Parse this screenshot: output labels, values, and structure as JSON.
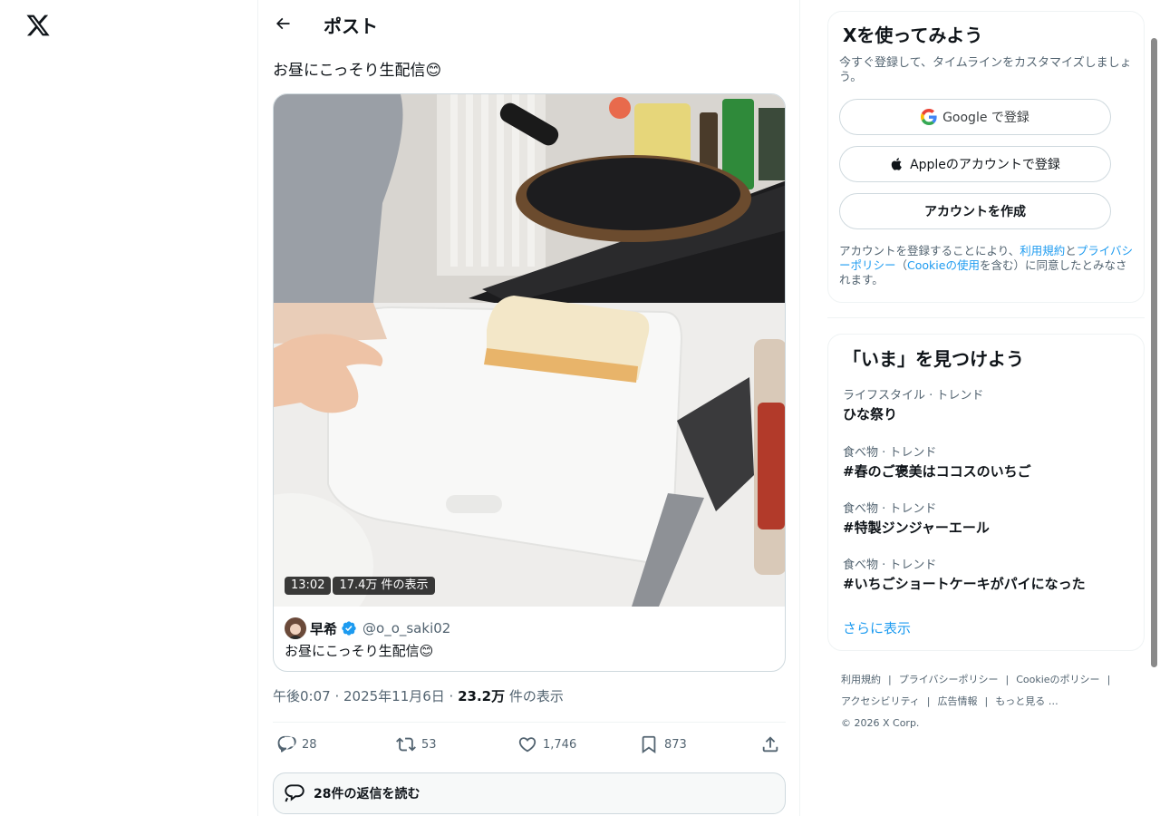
{
  "header": {
    "title": "ポスト"
  },
  "post": {
    "text": "お昼にこっそり生配信😊",
    "video": {
      "duration": "13:02",
      "views": "17.4万 件の表示"
    },
    "quote": {
      "name": "早希",
      "handle": "@o_o_saki02",
      "text": "お昼にこっそり生配信😊"
    },
    "time": "午後0:07 · 2025年11月6日 · ",
    "views_count": "23.2万",
    "views_label": " 件の表示",
    "actions": {
      "replies": "28",
      "reposts": "53",
      "likes": "1,746",
      "bookmarks": "873"
    },
    "read_replies": "28件の返信を読む"
  },
  "signup": {
    "title": "Xを使ってみよう",
    "description": "今すぐ登録して、タイムラインをカスタマイズしましょう。",
    "google_label": "Google で登録",
    "apple_label": "Appleのアカウントで登録",
    "create_label": "アカウントを作成",
    "terms_prefix": "アカウントを登録することにより、",
    "terms_link": "利用規約",
    "terms_and": "と",
    "privacy_link": "プライバシーポリシー",
    "cookie_open": "（",
    "cookie_link": "Cookieの使用",
    "terms_suffix": "を含む）に同意したとみなされます。"
  },
  "trends": {
    "title": "「いま」を見つけよう",
    "items": [
      {
        "category": "ライフスタイル · トレンド",
        "name": "ひな祭り"
      },
      {
        "category": "食べ物 · トレンド",
        "name": "#春のご褒美はココスのいちご"
      },
      {
        "category": "食べ物 · トレンド",
        "name": "#特製ジンジャーエール"
      },
      {
        "category": "食べ物 · トレンド",
        "name": "#いちごショートケーキがパイになった"
      }
    ],
    "show_more": "さらに表示"
  },
  "footer": {
    "links": [
      "利用規約",
      "プライバシーポリシー",
      "Cookieのポリシー",
      "アクセシビリティ",
      "広告情報",
      "もっと見る …"
    ],
    "copyright": "© 2026 X Corp."
  },
  "colors": {
    "accent": "#1d9bf0",
    "text": "#0f1419",
    "muted": "#536471",
    "border": "#cfd9de"
  }
}
